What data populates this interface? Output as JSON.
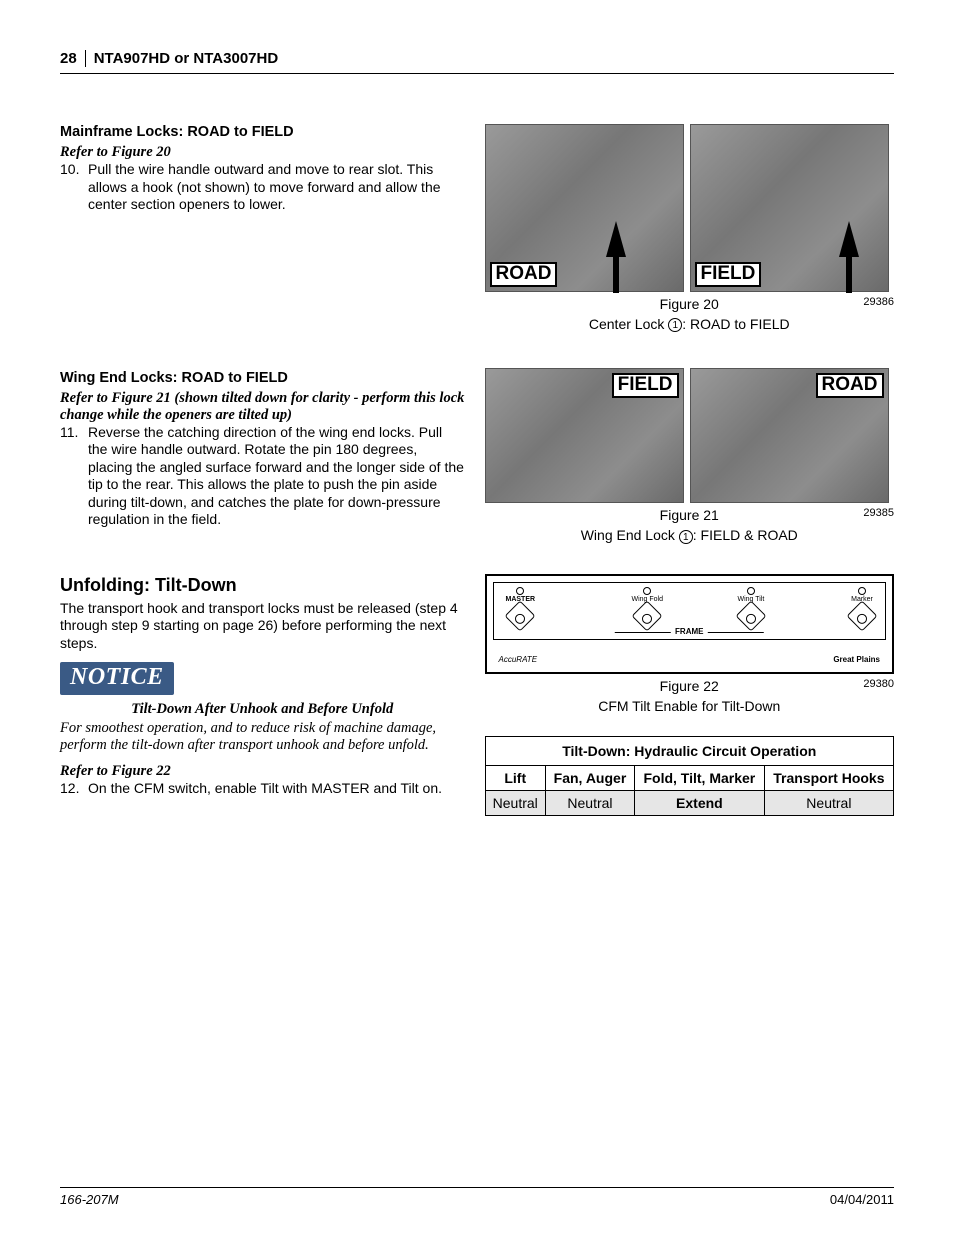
{
  "header": {
    "page_number": "28",
    "model": "NTA907HD or NTA3007HD"
  },
  "mainframe": {
    "heading": "Mainframe Locks: ROAD to FIELD",
    "refer": "Refer to Figure 20",
    "step_num": "10.",
    "step_text": "Pull the wire handle outward and move to rear slot. This allows a hook (not shown) to move forward and allow the center section openers to lower."
  },
  "wingend": {
    "heading": "Wing End Locks: ROAD to FIELD",
    "refer": "Refer to Figure 21 (shown tilted down for clarity - perform this lock change while the openers are tilted up)",
    "step_num": "11.",
    "step_text": "Reverse the catching direction of the wing end locks. Pull the wire handle outward. Rotate the pin 180 degrees, placing the angled surface forward and the longer side of the tip to the rear. This allows the plate to push the pin aside during tilt-down, and catches the plate for down-pressure regulation in the field."
  },
  "unfolding": {
    "heading": "Unfolding: Tilt-Down",
    "body": "The transport hook and transport locks must be released (step 4 through step 9 starting on page 26) before performing the next steps.",
    "notice_label": "NOTICE",
    "notice_title": "Tilt-Down After Unhook and Before Unfold",
    "notice_body": "For smoothest operation, and to reduce risk of machine damage, perform the tilt-down after transport unhook and before unfold.",
    "refer": "Refer to Figure 22",
    "step_num": "12.",
    "step_text": "On the CFM switch, enable Tilt with MASTER and Tilt on."
  },
  "fig20": {
    "label_road": "ROAD",
    "label_field": "FIELD",
    "caption_fig": "Figure 20",
    "id": "29386",
    "caption_text_prefix": "Center Lock ",
    "caption_text_suffix": ": ROAD to FIELD",
    "circled": "1"
  },
  "fig21": {
    "label_field": "FIELD",
    "label_road": "ROAD",
    "caption_fig": "Figure 21",
    "id": "29385",
    "caption_text_prefix": "Wing End Lock ",
    "caption_text_suffix": ": FIELD & ROAD",
    "circled": "1"
  },
  "fig22": {
    "switches": {
      "s1": "MASTER",
      "s2": "Wing Fold",
      "s3": "Wing Tilt",
      "s4": "Marker"
    },
    "frame": "FRAME",
    "brand_left": "AccuRATE",
    "brand_right": "Great Plains",
    "caption_fig": "Figure 22",
    "id": "29380",
    "caption_text": "CFM Tilt Enable for Tilt-Down"
  },
  "table": {
    "title": "Tilt-Down: Hydraulic Circuit Operation",
    "headers": {
      "h1": "Lift",
      "h2": "Fan, Auger",
      "h3": "Fold, Tilt, Marker",
      "h4": "Transport Hooks"
    },
    "row": {
      "c1": "Neutral",
      "c2": "Neutral",
      "c3": "Extend",
      "c4": "Neutral"
    }
  },
  "footer": {
    "left": "166-207M",
    "right": "04/04/2011"
  }
}
